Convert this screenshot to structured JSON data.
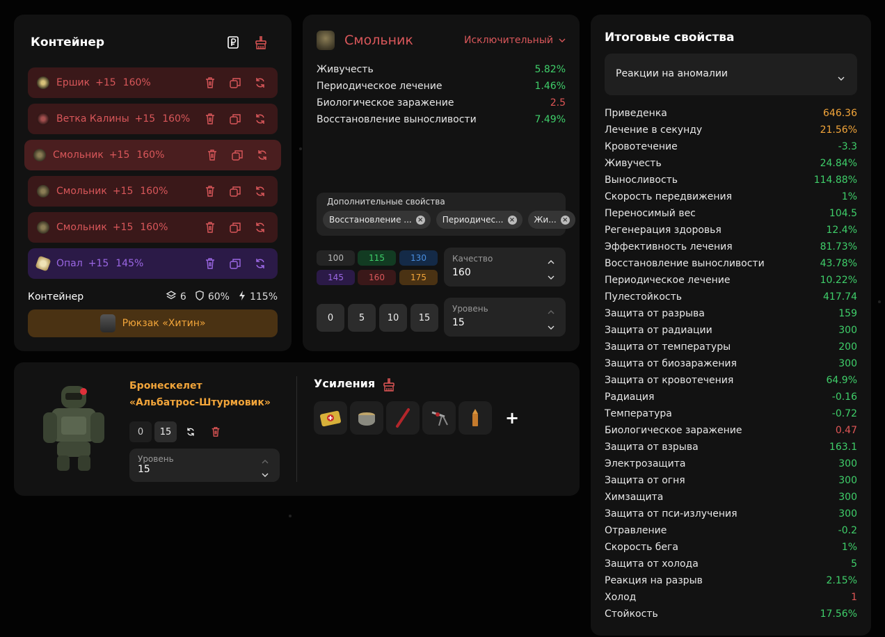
{
  "container": {
    "title": "Контейнер",
    "slots": [
      {
        "name": "Ершик",
        "plus": "+15",
        "pct": "160%"
      },
      {
        "name": "Ветка Калины",
        "plus": "+15",
        "pct": "160%"
      },
      {
        "name": "Смольник",
        "plus": "+15",
        "pct": "160%"
      },
      {
        "name": "Смольник",
        "plus": "+15",
        "pct": "160%"
      },
      {
        "name": "Смольник",
        "plus": "+15",
        "pct": "160%"
      },
      {
        "name": "Опал",
        "plus": "+15",
        "pct": "145%"
      }
    ],
    "footer": {
      "label": "Контейнер",
      "slots": "6",
      "protection": "60%",
      "efficiency": "115%"
    },
    "backpack": "Рюкзак «Хитин»"
  },
  "artifact": {
    "name": "Смольник",
    "rarity": "Исключительный",
    "props": [
      {
        "label": "Живучесть",
        "value": "5.82%"
      },
      {
        "label": "Периодическое лечение",
        "value": "1.46%"
      },
      {
        "label": "Биологическое заражение",
        "value": "2.5"
      },
      {
        "label": "Восстановление выносливости",
        "value": "7.49%"
      }
    ],
    "extra": {
      "label": "Дополнительные свойства",
      "chips": [
        "Восстановление ...",
        "Периодичес...",
        "Жи..."
      ]
    },
    "quality_buttons": [
      "100",
      "115",
      "130",
      "145",
      "160",
      "175"
    ],
    "quality": {
      "label": "Качество",
      "value": "160"
    },
    "level_buttons": [
      "0",
      "5",
      "10",
      "15"
    ],
    "level": {
      "label": "Уровень",
      "value": "15"
    }
  },
  "armor": {
    "name_line1": "Бронескелет",
    "name_line2": "«Альбатрос-Штурмовик»",
    "btn0": "0",
    "btn15": "15",
    "level": {
      "label": "Уровень",
      "value": "15"
    },
    "boosts_title": "Усиления",
    "plus": "+"
  },
  "final": {
    "title": "Итоговые свойства",
    "select": "Реакции на аномалии",
    "rows": [
      {
        "label": "Приведенка",
        "value": "646.36"
      },
      {
        "label": "Лечение в секунду",
        "value": "21.56%"
      },
      {
        "label": "Кровотечение",
        "value": "-3.3"
      },
      {
        "label": "Живучесть",
        "value": "24.84%"
      },
      {
        "label": "Выносливость",
        "value": "114.88%"
      },
      {
        "label": "Скорость передвижения",
        "value": "1%"
      },
      {
        "label": "Переносимый вес",
        "value": "104.5"
      },
      {
        "label": "Регенерация здоровья",
        "value": "12.4%"
      },
      {
        "label": "Эффективность лечения",
        "value": "81.73%"
      },
      {
        "label": "Восстановление выносливости",
        "value": "43.78%"
      },
      {
        "label": "Периодическое лечение",
        "value": "10.22%"
      },
      {
        "label": "Пулестойкость",
        "value": "417.74"
      },
      {
        "label": "Защита от разрыва",
        "value": "159"
      },
      {
        "label": "Защита от радиации",
        "value": "300"
      },
      {
        "label": "Защита от температуры",
        "value": "200"
      },
      {
        "label": "Защита от биозаражения",
        "value": "300"
      },
      {
        "label": "Защита от кровотечения",
        "value": "64.9%"
      },
      {
        "label": "Радиация",
        "value": "-0.16"
      },
      {
        "label": "Температура",
        "value": "-0.72"
      },
      {
        "label": "Биологическое заражение",
        "value": "0.47"
      },
      {
        "label": "Защита от взрыва",
        "value": "163.1"
      },
      {
        "label": "Электрозащита",
        "value": "300"
      },
      {
        "label": "Защита от огня",
        "value": "300"
      },
      {
        "label": "Химзащита",
        "value": "300"
      },
      {
        "label": "Защита от пси-излучения",
        "value": "300"
      },
      {
        "label": "Отравление",
        "value": "-0.2"
      },
      {
        "label": "Скорость бега",
        "value": "1%"
      },
      {
        "label": "Защита от холода",
        "value": "5"
      },
      {
        "label": "Реакция на разрыв",
        "value": "2.15%"
      },
      {
        "label": "Холод",
        "value": "1"
      },
      {
        "label": "Стойкость",
        "value": "17.56%"
      }
    ]
  },
  "colors": {
    "positive": "#3fcf6a",
    "negative": "#e05656",
    "highlight": "#f2a53a",
    "red_item": "#d9575a",
    "purple_item": "#9b67e4"
  }
}
